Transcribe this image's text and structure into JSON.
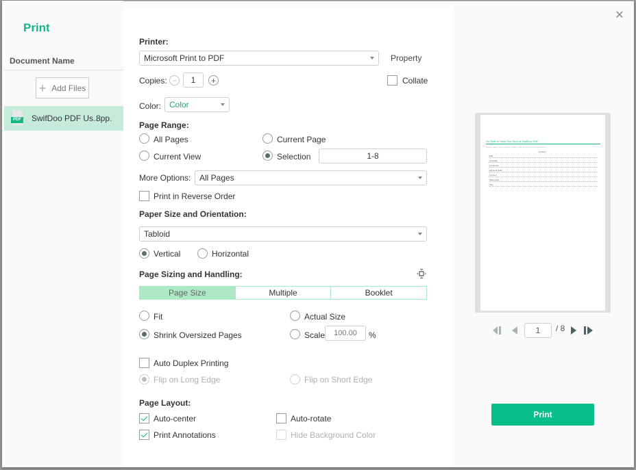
{
  "window": {
    "title": "Print",
    "close_icon": "close-icon"
  },
  "sidebar": {
    "document_header": "Document Name",
    "add_files_label": "Add Files",
    "documents": [
      {
        "name": "SwifDoo PDF Us..",
        "pages": "8pp.",
        "icon": "pdf-file-icon",
        "selected": true
      }
    ]
  },
  "printer": {
    "label": "Printer:",
    "selected": "Microsoft Print to PDF",
    "property_label": "Property"
  },
  "copies": {
    "label": "Copies:",
    "value": "1",
    "collate_label": "Collate",
    "collate_checked": false
  },
  "color": {
    "label": "Color:",
    "selected": "Color"
  },
  "page_range": {
    "label": "Page Range:",
    "options": [
      {
        "label": "All Pages",
        "checked": false
      },
      {
        "label": "Current Page",
        "checked": false
      },
      {
        "label": "Current View",
        "checked": false
      },
      {
        "label": "Selection",
        "checked": true
      }
    ],
    "selection_value": "1-8",
    "more_options_label": "More Options:",
    "more_options_selected": "All Pages",
    "reverse_label": "Print in Reverse Order",
    "reverse_checked": false
  },
  "paper": {
    "label": "Paper Size and Orientation:",
    "size_selected": "Tabloid",
    "orientations": [
      {
        "label": "Vertical",
        "checked": true
      },
      {
        "label": "Horizontal",
        "checked": false
      }
    ]
  },
  "sizing": {
    "label": "Page Sizing and Handling:",
    "tabs": [
      {
        "label": "Page Size",
        "active": true
      },
      {
        "label": "Multiple",
        "active": false
      },
      {
        "label": "Booklet",
        "active": false
      }
    ],
    "options": [
      {
        "label": "Fit",
        "checked": false
      },
      {
        "label": "Actual Size",
        "checked": false
      },
      {
        "label": "Shrink Oversized Pages",
        "checked": true
      },
      {
        "label": "Scale",
        "checked": false
      }
    ],
    "scale_value": "100.00",
    "scale_unit": "%"
  },
  "duplex": {
    "label": "Auto Duplex Printing",
    "checked": false,
    "long_edge_label": "Flip on Long Edge",
    "short_edge_label": "Flip on Short Edge"
  },
  "layout": {
    "label": "Page Layout:",
    "auto_center_label": "Auto-center",
    "auto_center_checked": true,
    "auto_rotate_label": "Auto-rotate",
    "auto_rotate_checked": false,
    "annotations_label": "Print Annotations",
    "annotations_checked": true,
    "hide_bg_label": "Hide Background Color",
    "hide_bg_checked": false
  },
  "preview": {
    "doc_title": "So Glad to Have You Here at SwifDoo PDF",
    "doc_subtitle": "Please take a few minutes to learn how we improve your efficiency",
    "contents_label": "Content",
    "toc": [
      "Edit",
      "Annotate",
      "Compress",
      "Merge & Split",
      "Convert",
      "Watermark",
      "Sign"
    ],
    "current_page": "1",
    "total_pages": "/ 8"
  },
  "print_button_label": "Print",
  "colors": {
    "accent": "#13b886",
    "print_button": "#08bf8a",
    "selected_row": "#c6ebdb",
    "active_tab": "#aee9c5"
  }
}
